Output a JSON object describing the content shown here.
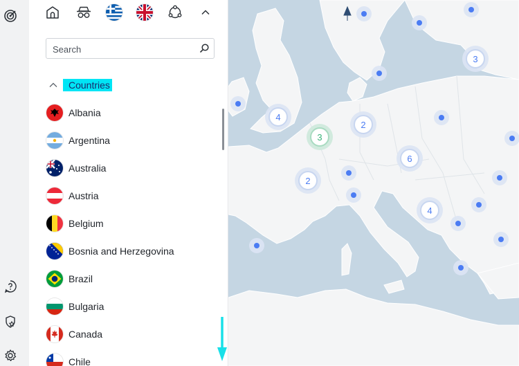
{
  "search": {
    "placeholder": "Search"
  },
  "countries": {
    "section_label": "Countries",
    "items": [
      {
        "name": "Albania"
      },
      {
        "name": "Argentina"
      },
      {
        "name": "Australia"
      },
      {
        "name": "Austria"
      },
      {
        "name": "Belgium"
      },
      {
        "name": "Bosnia and Herzegovina"
      },
      {
        "name": "Brazil"
      },
      {
        "name": "Bulgaria"
      },
      {
        "name": "Canada"
      },
      {
        "name": "Chile"
      }
    ]
  },
  "map": {
    "clusters": [
      {
        "label": "4",
        "status": "available"
      },
      {
        "label": "3",
        "status": "connected"
      },
      {
        "label": "2",
        "status": "available"
      },
      {
        "label": "2",
        "status": "available"
      },
      {
        "label": "6",
        "status": "available"
      },
      {
        "label": "4",
        "status": "available"
      },
      {
        "label": "3",
        "status": "available"
      }
    ]
  },
  "colors": {
    "accent": "#4b7cf3",
    "highlight": "#00e5f5",
    "connected": "#3ab37a",
    "sea": "#c5d6e3",
    "land": "#f4f5f6"
  }
}
